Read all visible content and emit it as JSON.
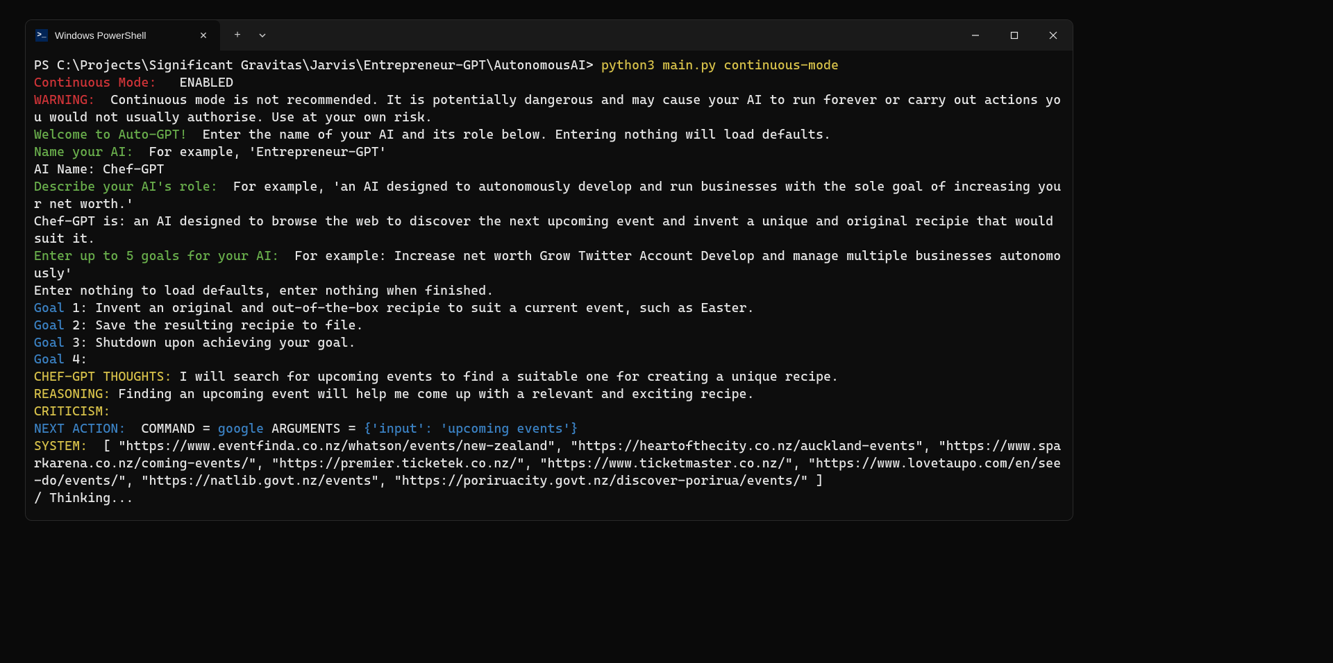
{
  "window": {
    "tab_title": "Windows PowerShell",
    "tab_icon_glyph": ">_"
  },
  "term": {
    "prompt_path": "PS C:\\Projects\\Significant Gravitas\\Jarvis\\Entrepreneur-GPT\\AutonomousAI>",
    "command": " python3 main.py continuous-mode",
    "continuous_label": "Continuous Mode: ",
    "continuous_value": "  ENABLED",
    "warning_label": "WARNING: ",
    "warning_text": " Continuous mode is not recommended. It is potentially dangerous and may cause your AI to run forever or carry out actions you would not usually authorise. Use at your own risk.",
    "welcome_label": "Welcome to Auto-GPT! ",
    "welcome_text": " Enter the name of your AI and its role below. Entering nothing will load defaults.",
    "name_label": "Name your AI: ",
    "name_example": " For example, 'Entrepreneur-GPT'",
    "ai_name_line": "AI Name: Chef-GPT",
    "describe_label": "Describe your AI's role: ",
    "describe_text": " For example, 'an AI designed to autonomously develop and run businesses with the sole goal of increasing your net worth.'",
    "chef_is": "Chef-GPT is: an AI designed to browse the web to discover the next upcoming event and invent a unique and original recipie that would suit it.",
    "goals_label": "Enter up to 5 goals for your AI: ",
    "goals_example": " For example: Increase net worth Grow Twitter Account Develop and manage multiple businesses autonomously'",
    "goals_hint": "Enter nothing to load defaults, enter nothing when finished.",
    "goal1_label": "Goal",
    "goal1_text": " 1: Invent an original and out-of-the-box recipie to suit a current event, such as Easter.",
    "goal2_label": "Goal",
    "goal2_text": " 2: Save the resulting recipie to file.",
    "goal3_label": "Goal",
    "goal3_text": " 3: Shutdown upon achieving your goal.",
    "goal4_label": "Goal",
    "goal4_text": " 4:",
    "thoughts_label": "CHEF-GPT THOUGHTS:",
    "thoughts_text": " I will search for upcoming events to find a suitable one for creating a unique recipe.",
    "reasoning_label": "REASONING:",
    "reasoning_text": " Finding an upcoming event will help me come up with a relevant and exciting recipe.",
    "criticism_label": "CRITICISM:",
    "next_action_label": "NEXT ACTION: ",
    "next_action_cmd_label": " COMMAND = ",
    "next_action_cmd": "google",
    "next_action_args_label": " ARGUMENTS = ",
    "next_action_args": "{'input': 'upcoming events'}",
    "system_label": "SYSTEM: ",
    "system_text": " [ \"https://www.eventfinda.co.nz/whatson/events/new-zealand\", \"https://heartofthecity.co.nz/auckland-events\", \"https://www.sparkarena.co.nz/coming-events/\", \"https://premier.ticketek.co.nz/\", \"https://www.ticketmaster.co.nz/\", \"https://www.lovetaupo.com/en/see-do/events/\", \"https://natlib.govt.nz/events\", \"https://poriruacity.govt.nz/discover-porirua/events/\" ]",
    "thinking": "/ Thinking..."
  }
}
